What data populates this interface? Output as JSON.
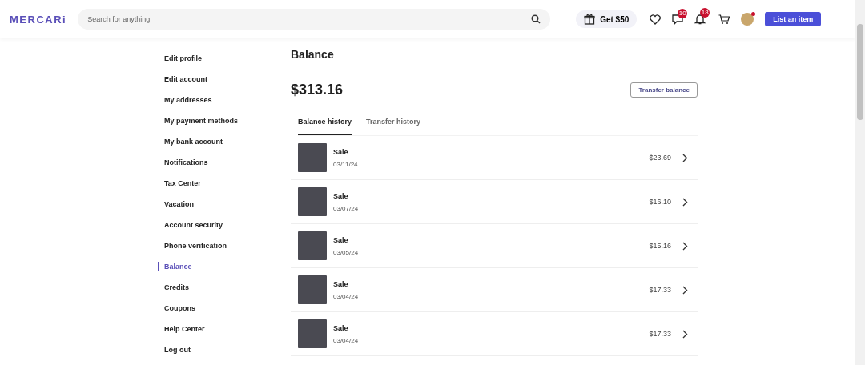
{
  "header": {
    "logo": "MERCARi",
    "search": {
      "placeholder": "Search for anything"
    },
    "promo": "Get $50",
    "messages_badge": "10",
    "notifications_badge": "18",
    "avatar_dot": true,
    "list_button": "List an item"
  },
  "sidebar": {
    "items": [
      {
        "label": "Edit profile",
        "selected": false
      },
      {
        "label": "Edit account",
        "selected": false
      },
      {
        "label": "My addresses",
        "selected": false
      },
      {
        "label": "My payment methods",
        "selected": false
      },
      {
        "label": "My bank account",
        "selected": false
      },
      {
        "label": "Notifications",
        "selected": false
      },
      {
        "label": "Tax Center",
        "selected": false
      },
      {
        "label": "Vacation",
        "selected": false
      },
      {
        "label": "Account security",
        "selected": false
      },
      {
        "label": "Phone verification",
        "selected": false
      },
      {
        "label": "Balance",
        "selected": true
      },
      {
        "label": "Credits",
        "selected": false
      },
      {
        "label": "Coupons",
        "selected": false
      },
      {
        "label": "Help Center",
        "selected": false
      },
      {
        "label": "Log out",
        "selected": false
      }
    ]
  },
  "main": {
    "title": "Balance",
    "amount": "$313.16",
    "transfer_button": "Transfer balance",
    "tabs": [
      {
        "label": "Balance history",
        "selected": true
      },
      {
        "label": "Transfer history",
        "selected": false
      }
    ],
    "rows": [
      {
        "type": "Sale",
        "date": "03/11/24",
        "amount": "$23.69"
      },
      {
        "type": "Sale",
        "date": "03/07/24",
        "amount": "$16.10"
      },
      {
        "type": "Sale",
        "date": "03/05/24",
        "amount": "$15.16"
      },
      {
        "type": "Sale",
        "date": "03/04/24",
        "amount": "$17.33"
      },
      {
        "type": "Sale",
        "date": "03/04/24",
        "amount": "$17.33"
      }
    ]
  }
}
